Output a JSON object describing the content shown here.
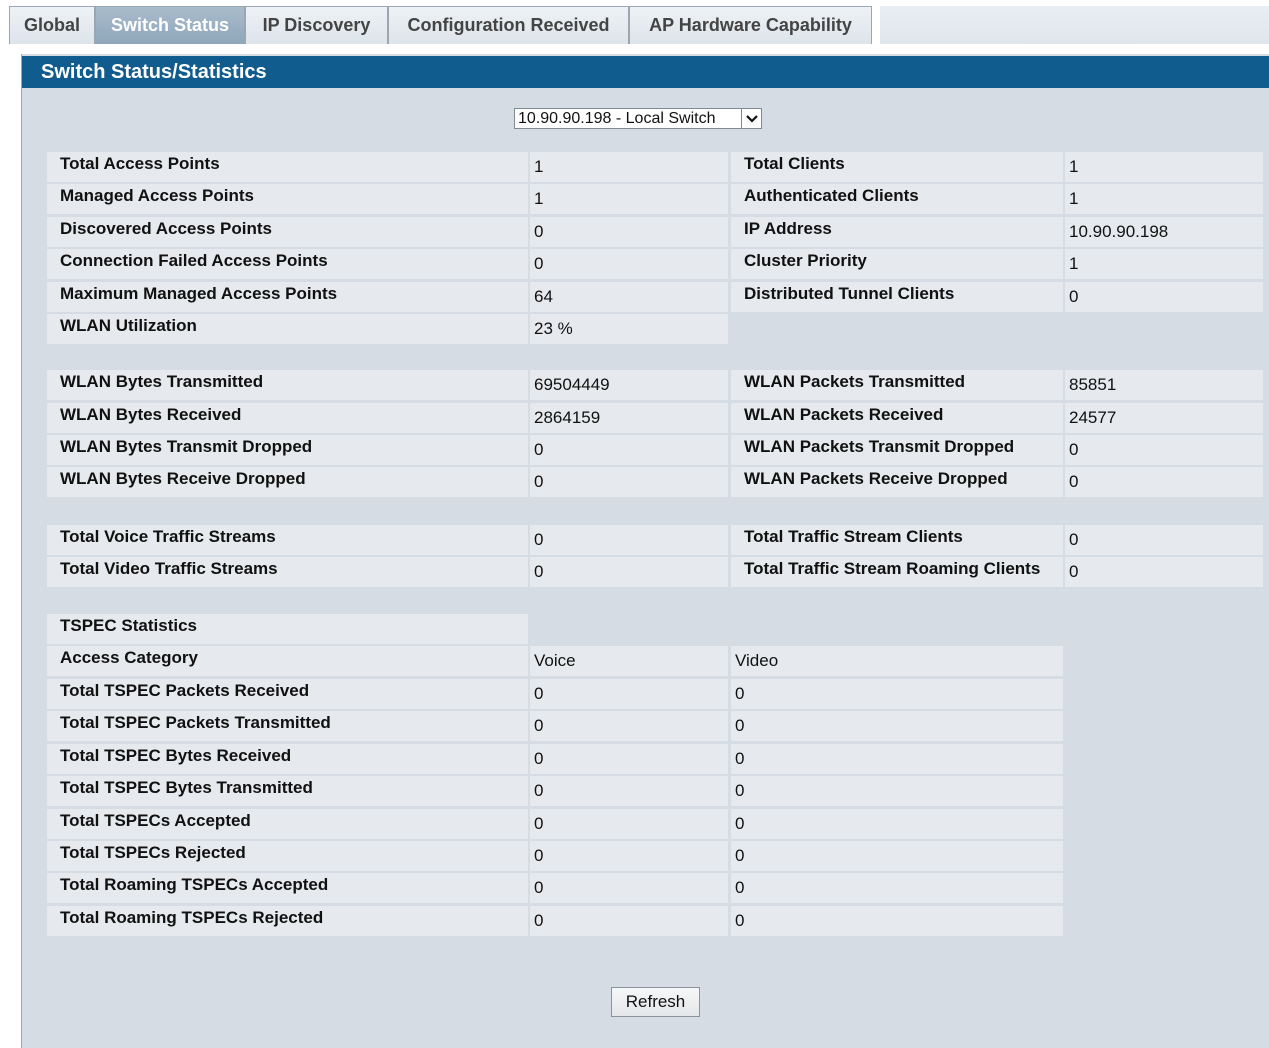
{
  "tabs": [
    "Global",
    "Switch Status",
    "IP Discovery",
    "Configuration Received",
    "AP Hardware Capability"
  ],
  "active_tab": "Switch Status",
  "panel_title": "Switch Status/Statistics",
  "switch_select": {
    "value": "10.90.90.198 - Local Switch"
  },
  "status": {
    "left": [
      {
        "label": "Total Access Points",
        "value": "1"
      },
      {
        "label": "Managed Access Points",
        "value": "1"
      },
      {
        "label": "Discovered Access Points",
        "value": "0"
      },
      {
        "label": "Connection Failed Access Points",
        "value": "0"
      },
      {
        "label": "Maximum Managed Access Points",
        "value": "64"
      },
      {
        "label": "WLAN Utilization",
        "value": "23 %"
      }
    ],
    "right": [
      {
        "label": "Total Clients",
        "value": "1"
      },
      {
        "label": "Authenticated Clients",
        "value": "1"
      },
      {
        "label": "IP Address",
        "value": "10.90.90.198"
      },
      {
        "label": "Cluster Priority",
        "value": "1"
      },
      {
        "label": "Distributed Tunnel Clients",
        "value": "0"
      }
    ]
  },
  "wlan": {
    "left": [
      {
        "label": "WLAN Bytes Transmitted",
        "value": "69504449"
      },
      {
        "label": "WLAN Bytes Received",
        "value": "2864159"
      },
      {
        "label": "WLAN Bytes Transmit Dropped",
        "value": "0"
      },
      {
        "label": "WLAN Bytes Receive Dropped",
        "value": "0"
      }
    ],
    "right": [
      {
        "label": "WLAN Packets Transmitted",
        "value": "85851"
      },
      {
        "label": "WLAN Packets Received",
        "value": "24577"
      },
      {
        "label": "WLAN Packets Transmit Dropped",
        "value": "0"
      },
      {
        "label": "WLAN Packets Receive Dropped",
        "value": "0"
      }
    ]
  },
  "traffic": {
    "left": [
      {
        "label": "Total Voice Traffic Streams",
        "value": "0"
      },
      {
        "label": "Total Video Traffic Streams",
        "value": "0"
      }
    ],
    "right": [
      {
        "label": "Total Traffic Stream Clients",
        "value": "0"
      },
      {
        "label": "Total Traffic Stream Roaming Clients",
        "value": "0"
      }
    ]
  },
  "tspec": {
    "title": "TSPEC Statistics",
    "header": {
      "label": "Access Category",
      "voice": "Voice",
      "video": "Video"
    },
    "rows": [
      {
        "label": "Total TSPEC Packets Received",
        "voice": "0",
        "video": "0"
      },
      {
        "label": "Total TSPEC Packets Transmitted",
        "voice": "0",
        "video": "0"
      },
      {
        "label": "Total TSPEC Bytes Received",
        "voice": "0",
        "video": "0"
      },
      {
        "label": "Total TSPEC Bytes Transmitted",
        "voice": "0",
        "video": "0"
      },
      {
        "label": "Total TSPECs Accepted",
        "voice": "0",
        "video": "0"
      },
      {
        "label": "Total TSPECs Rejected",
        "voice": "0",
        "video": "0"
      },
      {
        "label": "Total Roaming TSPECs Accepted",
        "voice": "0",
        "video": "0"
      },
      {
        "label": "Total Roaming TSPECs Rejected",
        "voice": "0",
        "video": "0"
      }
    ]
  },
  "refresh_label": "Refresh"
}
